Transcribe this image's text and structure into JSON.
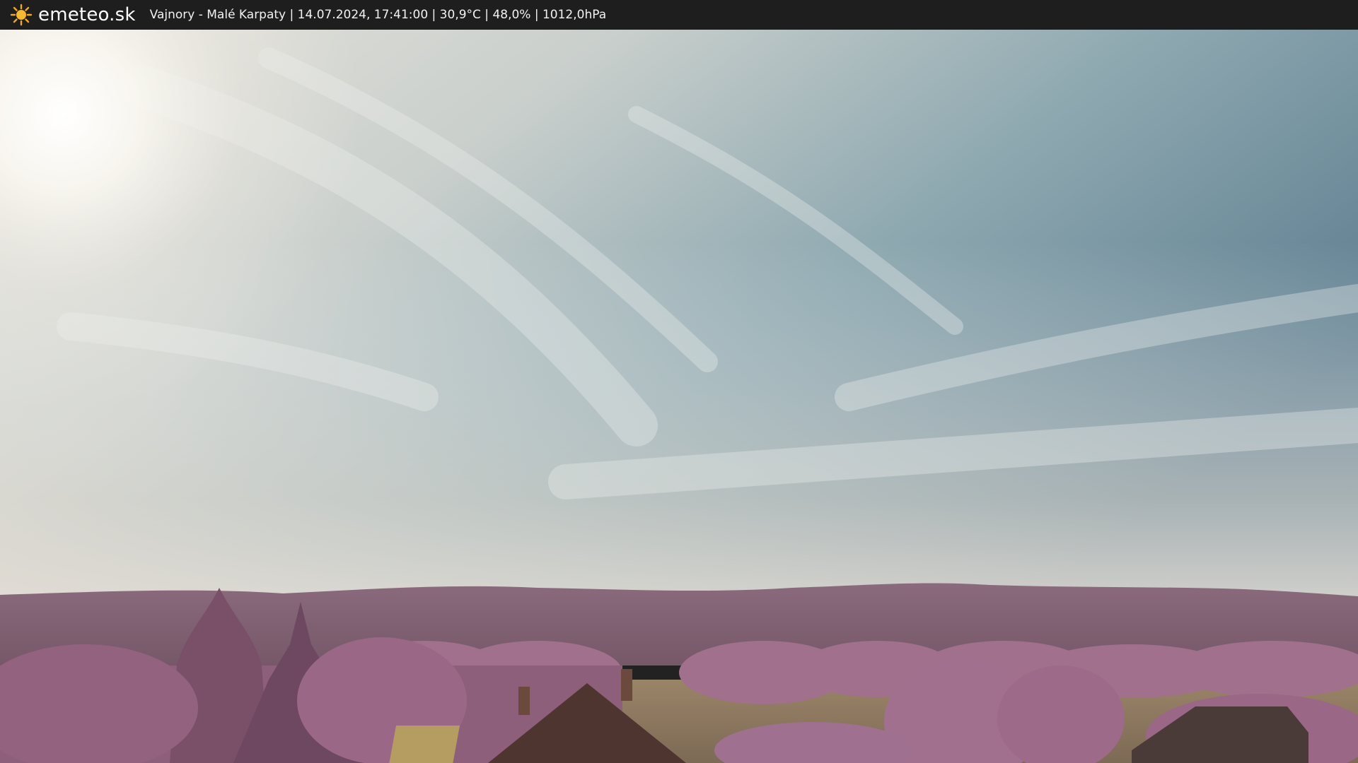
{
  "header": {
    "logo_icon": "sun-icon",
    "brand": "emeteo.sk",
    "caption": "Vajnory - Malé Karpaty | 14.07.2024, 17:41:00 | 30,9°C | 48,0% | 1012,0hPa"
  },
  "colors": {
    "topbar": "#1e1e1e",
    "sun": "#f5a623",
    "sky_top": "#5f7f91",
    "sky_haze": "#d8d2c8",
    "foliage": "#9b6a86",
    "field": "#8e7a62"
  }
}
